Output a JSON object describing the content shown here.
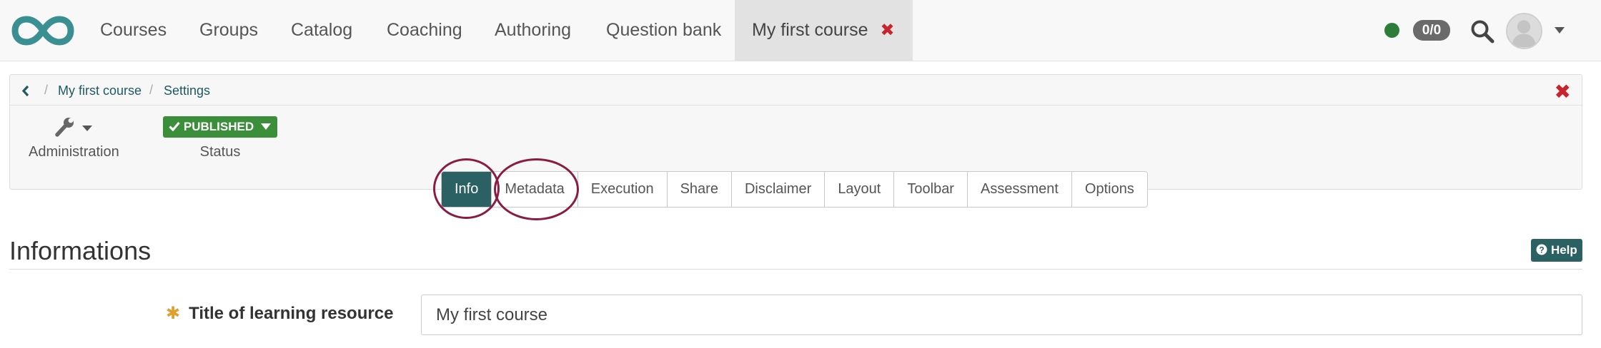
{
  "nav": {
    "items": [
      "Courses",
      "Groups",
      "Catalog",
      "Coaching",
      "Authoring",
      "Question bank"
    ],
    "active_tab": {
      "label": "My first course",
      "close_glyph": "✖"
    },
    "notification_count": "0/0",
    "status_color": "#2d7d39"
  },
  "breadcrumb": {
    "course": "My first course",
    "current": "Settings",
    "separator": "/"
  },
  "toolbar": {
    "administration_label": "Administration",
    "status_button": "PUBLISHED",
    "status_label": "Status",
    "close_glyph": "✖"
  },
  "tabs": [
    "Info",
    "Metadata",
    "Execution",
    "Share",
    "Disclaimer",
    "Layout",
    "Toolbar",
    "Assessment",
    "Options"
  ],
  "active_tab_index": 0,
  "highlighted_tabs": [
    "Info",
    "Metadata"
  ],
  "content": {
    "title": "Informations",
    "help_label": "Help",
    "field_label": "Title of learning resource",
    "field_required_mark": "✱",
    "field_value": "My first course"
  },
  "colors": {
    "brand": "#2b6162",
    "published": "#3c8f3a",
    "close": "#c9232b",
    "highlight": "#8a1c44",
    "required": "#e0a030"
  },
  "icons": [
    "logo-infinity-icon",
    "search-icon",
    "avatar-icon",
    "chevron-down-icon",
    "chevron-left-icon",
    "wrench-icon",
    "checkmark-icon",
    "close-icon",
    "question-circle-icon"
  ]
}
